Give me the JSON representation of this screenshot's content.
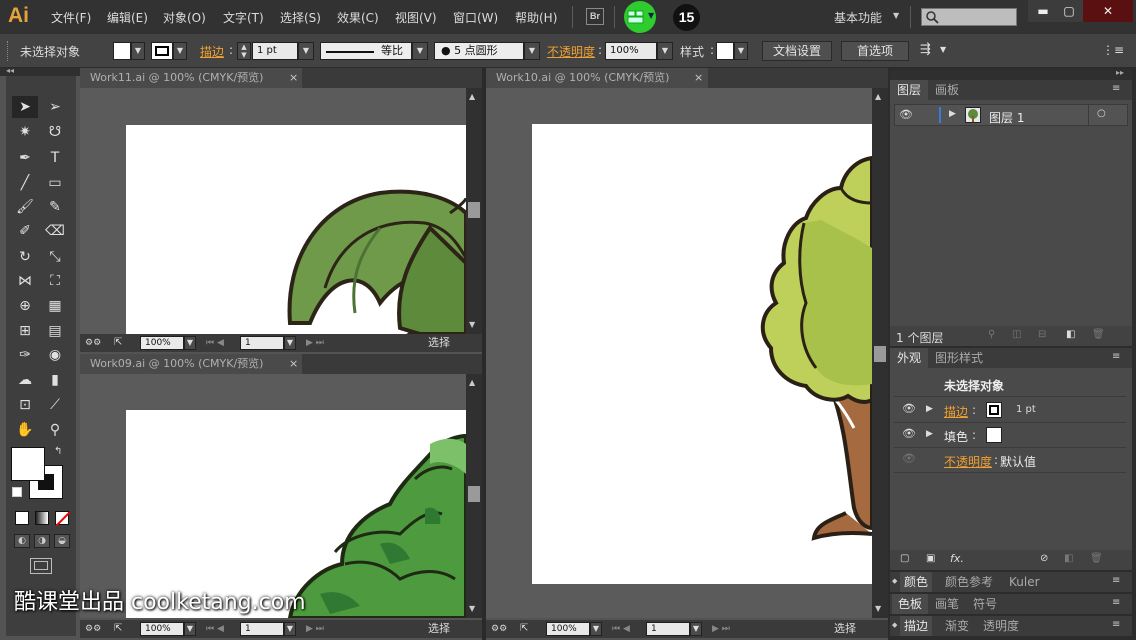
{
  "app": {
    "logo": "Ai",
    "badge": "15",
    "br_label": "Br",
    "workspace": "基本功能"
  },
  "menu": [
    "文件(F)",
    "编辑(E)",
    "对象(O)",
    "文字(T)",
    "选择(S)",
    "效果(C)",
    "视图(V)",
    "窗口(W)",
    "帮助(H)"
  ],
  "window_buttons": {
    "minimize": "▬",
    "maximize": "▢",
    "close": "✕"
  },
  "control": {
    "no_selection": "未选择对象",
    "stroke_label": "描边",
    "stroke_value": "1 pt",
    "stroke_style": "等比",
    "brush": "5 点圆形",
    "opacity_label": "不透明度",
    "opacity_value": "100%",
    "style_label": "样式",
    "doc_settings": "文档设置",
    "preferences": "首选项"
  },
  "docs": {
    "tl": {
      "title": "Work11.ai @ 100% (CMYK/预览)",
      "zoom": "100%",
      "page": "1",
      "status": "选择"
    },
    "bl": {
      "title": "Work09.ai @ 100% (CMYK/预览)",
      "zoom": "100%",
      "page": "1",
      "status": "选择"
    },
    "right": {
      "title": "Work10.ai @ 100% (CMYK/预览)",
      "zoom": "100%",
      "page": "1",
      "status": "选择"
    }
  },
  "layers_panel": {
    "tabs": [
      "图层",
      "画板"
    ],
    "layer_name": "图层 1",
    "count": "1 个图层"
  },
  "appearance_panel": {
    "tabs": [
      "外观",
      "图形样式"
    ],
    "header": "未选择对象",
    "stroke_label": "描边",
    "stroke_value": "1 pt",
    "fill_label": "填色",
    "opacity_label": "不透明度",
    "opacity_value": "默认值"
  },
  "collapsed_panels": [
    [
      "颜色",
      "颜色参考",
      "Kuler"
    ],
    [
      "色板",
      "画笔",
      "符号"
    ],
    [
      "描边",
      "渐变",
      "透明度"
    ]
  ],
  "watermark": "酷课堂出品 coolketang.com",
  "colors": {
    "accent": "#f0a030",
    "green_dot": "#2ecc2e",
    "bg": "#535353"
  }
}
